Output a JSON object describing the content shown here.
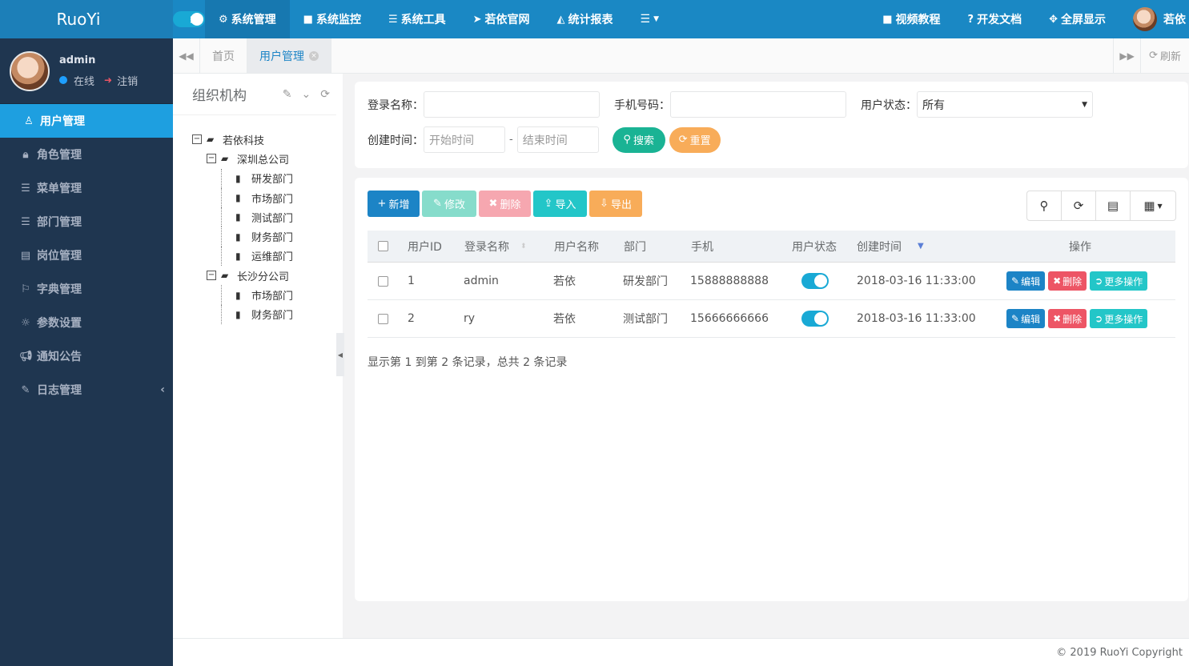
{
  "app": {
    "logo": "RuoYi"
  },
  "user": {
    "name": "admin",
    "status": "在线",
    "logout": "注销"
  },
  "sidebar": {
    "items": [
      {
        "label": "用户管理",
        "icon": "user-icon",
        "glyph": "♙"
      },
      {
        "label": "角色管理",
        "icon": "lock-icon",
        "glyph": "🔒︎"
      },
      {
        "label": "菜单管理",
        "icon": "list-icon",
        "glyph": "☰"
      },
      {
        "label": "部门管理",
        "icon": "outdent-icon",
        "glyph": "☰"
      },
      {
        "label": "岗位管理",
        "icon": "id-card-icon",
        "glyph": "▤"
      },
      {
        "label": "字典管理",
        "icon": "bookmark-icon",
        "glyph": "⚐"
      },
      {
        "label": "参数设置",
        "icon": "sun-icon",
        "glyph": "☼"
      },
      {
        "label": "通知公告",
        "icon": "bullhorn-icon",
        "glyph": "📢︎"
      },
      {
        "label": "日志管理",
        "icon": "edit-icon",
        "glyph": "✎"
      }
    ]
  },
  "topnav": {
    "items": [
      {
        "label": "系统管理",
        "icon": "gear-icon",
        "glyph": "⚙"
      },
      {
        "label": "系统监控",
        "icon": "video-icon",
        "glyph": "■"
      },
      {
        "label": "系统工具",
        "icon": "bars-icon",
        "glyph": "☰"
      },
      {
        "label": "若依官网",
        "icon": "location-arrow-icon",
        "glyph": "➤"
      },
      {
        "label": "统计报表",
        "icon": "area-chart-icon",
        "glyph": "◭"
      }
    ],
    "right": [
      {
        "label": "视频教程",
        "icon": "video-icon",
        "glyph": "■"
      },
      {
        "label": "开发文档",
        "icon": "question-circle-icon",
        "glyph": "?"
      },
      {
        "label": "全屏显示",
        "icon": "arrows-icon",
        "glyph": "✥"
      }
    ],
    "username": "若依"
  },
  "tabs": {
    "home": "首页",
    "active": "用户管理",
    "refresh": "刷新"
  },
  "org": {
    "title": "组织机构",
    "tree": {
      "root": "若依科技",
      "branch1": "深圳总公司",
      "dept1": "研发部门",
      "dept2": "市场部门",
      "dept3": "测试部门",
      "dept4": "财务部门",
      "dept5": "运维部门",
      "branch2": "长沙分公司",
      "dept6": "市场部门",
      "dept7": "财务部门"
    }
  },
  "search": {
    "login_label": "登录名称：",
    "phone_label": "手机号码：",
    "status_label": "用户状态：",
    "status_value": "所有",
    "time_label": "创建时间：",
    "start_placeholder": "开始时间",
    "end_placeholder": "结束时间",
    "dash": "-",
    "search_btn": "搜索",
    "reset_btn": "重置"
  },
  "toolbar": {
    "add": "新增",
    "edit": "修改",
    "delete": "删除",
    "import": "导入",
    "export": "导出"
  },
  "table": {
    "headers": {
      "id": "用户ID",
      "login": "登录名称",
      "name": "用户名称",
      "dept": "部门",
      "phone": "手机",
      "status": "用户状态",
      "created": "创建时间",
      "ops": "操作"
    },
    "rows": [
      {
        "id": "1",
        "login": "admin",
        "name": "若依",
        "dept": "研发部门",
        "phone": "15888888888",
        "created": "2018-03-16 11:33:00"
      },
      {
        "id": "2",
        "login": "ry",
        "name": "若依",
        "dept": "测试部门",
        "phone": "15666666666",
        "created": "2018-03-16 11:33:00"
      }
    ],
    "actions": {
      "edit": "编辑",
      "delete": "删除",
      "more": "更多操作"
    },
    "summary": "显示第 1 到第 2 条记录，总共 2 条记录"
  },
  "footer": "© 2019 RuoYi Copyright",
  "colors": {
    "sidebar": "#1f3650",
    "topnav": "#1a88c4",
    "primary": "#1c84c6",
    "success": "#1ab394",
    "danger": "#ed5565",
    "warning": "#f8ac59",
    "info": "#23c6c8"
  }
}
